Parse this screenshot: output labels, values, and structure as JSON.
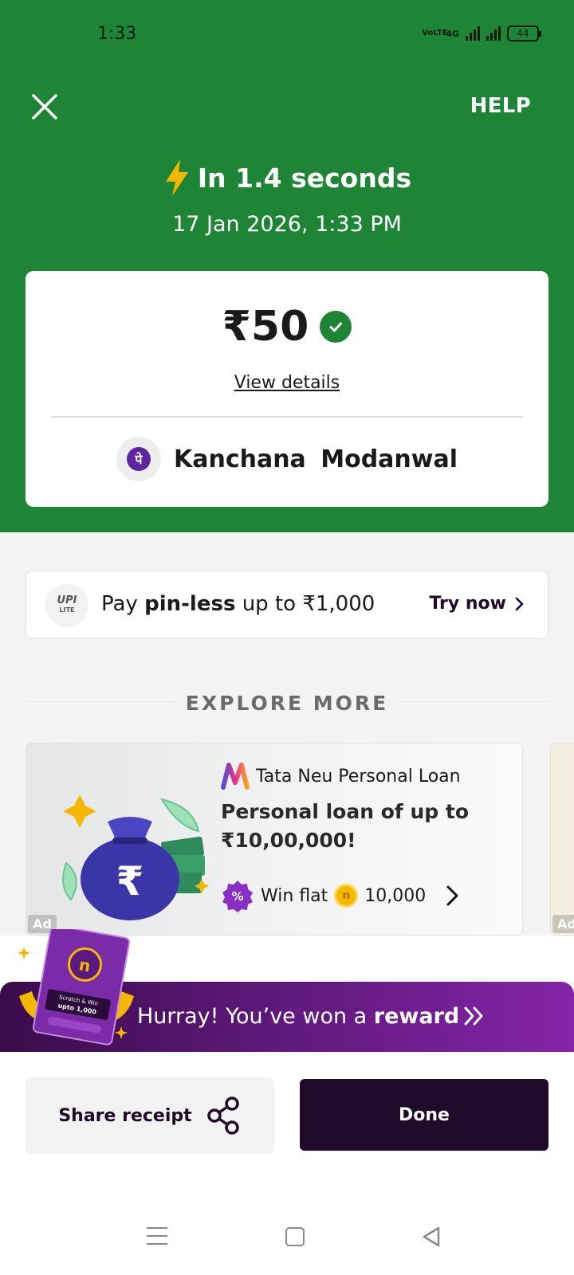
{
  "status_bar": {
    "time": "1:33",
    "network": "VoLTE",
    "net_type": "4G",
    "battery": "44"
  },
  "header": {
    "help_label": "HELP",
    "speed_text": "In 1.4 seconds",
    "datetime": "17 Jan 2026, 1:33 PM",
    "bg_color": "#1e8537"
  },
  "transaction": {
    "amount": "₹50",
    "status": "success",
    "view_details_label": "View details",
    "payee_name": "Kanchana  Modanwal",
    "payee_logo_icon": "phonepe-logo"
  },
  "upi_lite": {
    "logo_text": "UPI",
    "logo_sub": "LITE",
    "text_pre": "Pay ",
    "text_bold": "pin-less",
    "text_post": " up to ₹1,000",
    "cta_label": "Try now"
  },
  "explore": {
    "heading": "EXPLORE MORE",
    "ads": [
      {
        "brand": "Tata Neu Personal Loan",
        "title": "Personal loan of up to ₹10,00,000!",
        "win_label": "Win flat",
        "win_amount": "10,000",
        "ad_tag": "Ad"
      },
      {
        "ad_tag": "Ad"
      }
    ]
  },
  "reward": {
    "text_pre": "Hurray! You’ve won a ",
    "text_bold": "reward",
    "card_line1": "Scratch & Win",
    "card_line2": "upto 1,000"
  },
  "actions": {
    "share_label": "Share receipt",
    "done_label": "Done"
  },
  "colors": {
    "accent_dark": "#1f0a2a",
    "success_green": "#1e8537",
    "reward_purple": "#5c1878"
  }
}
